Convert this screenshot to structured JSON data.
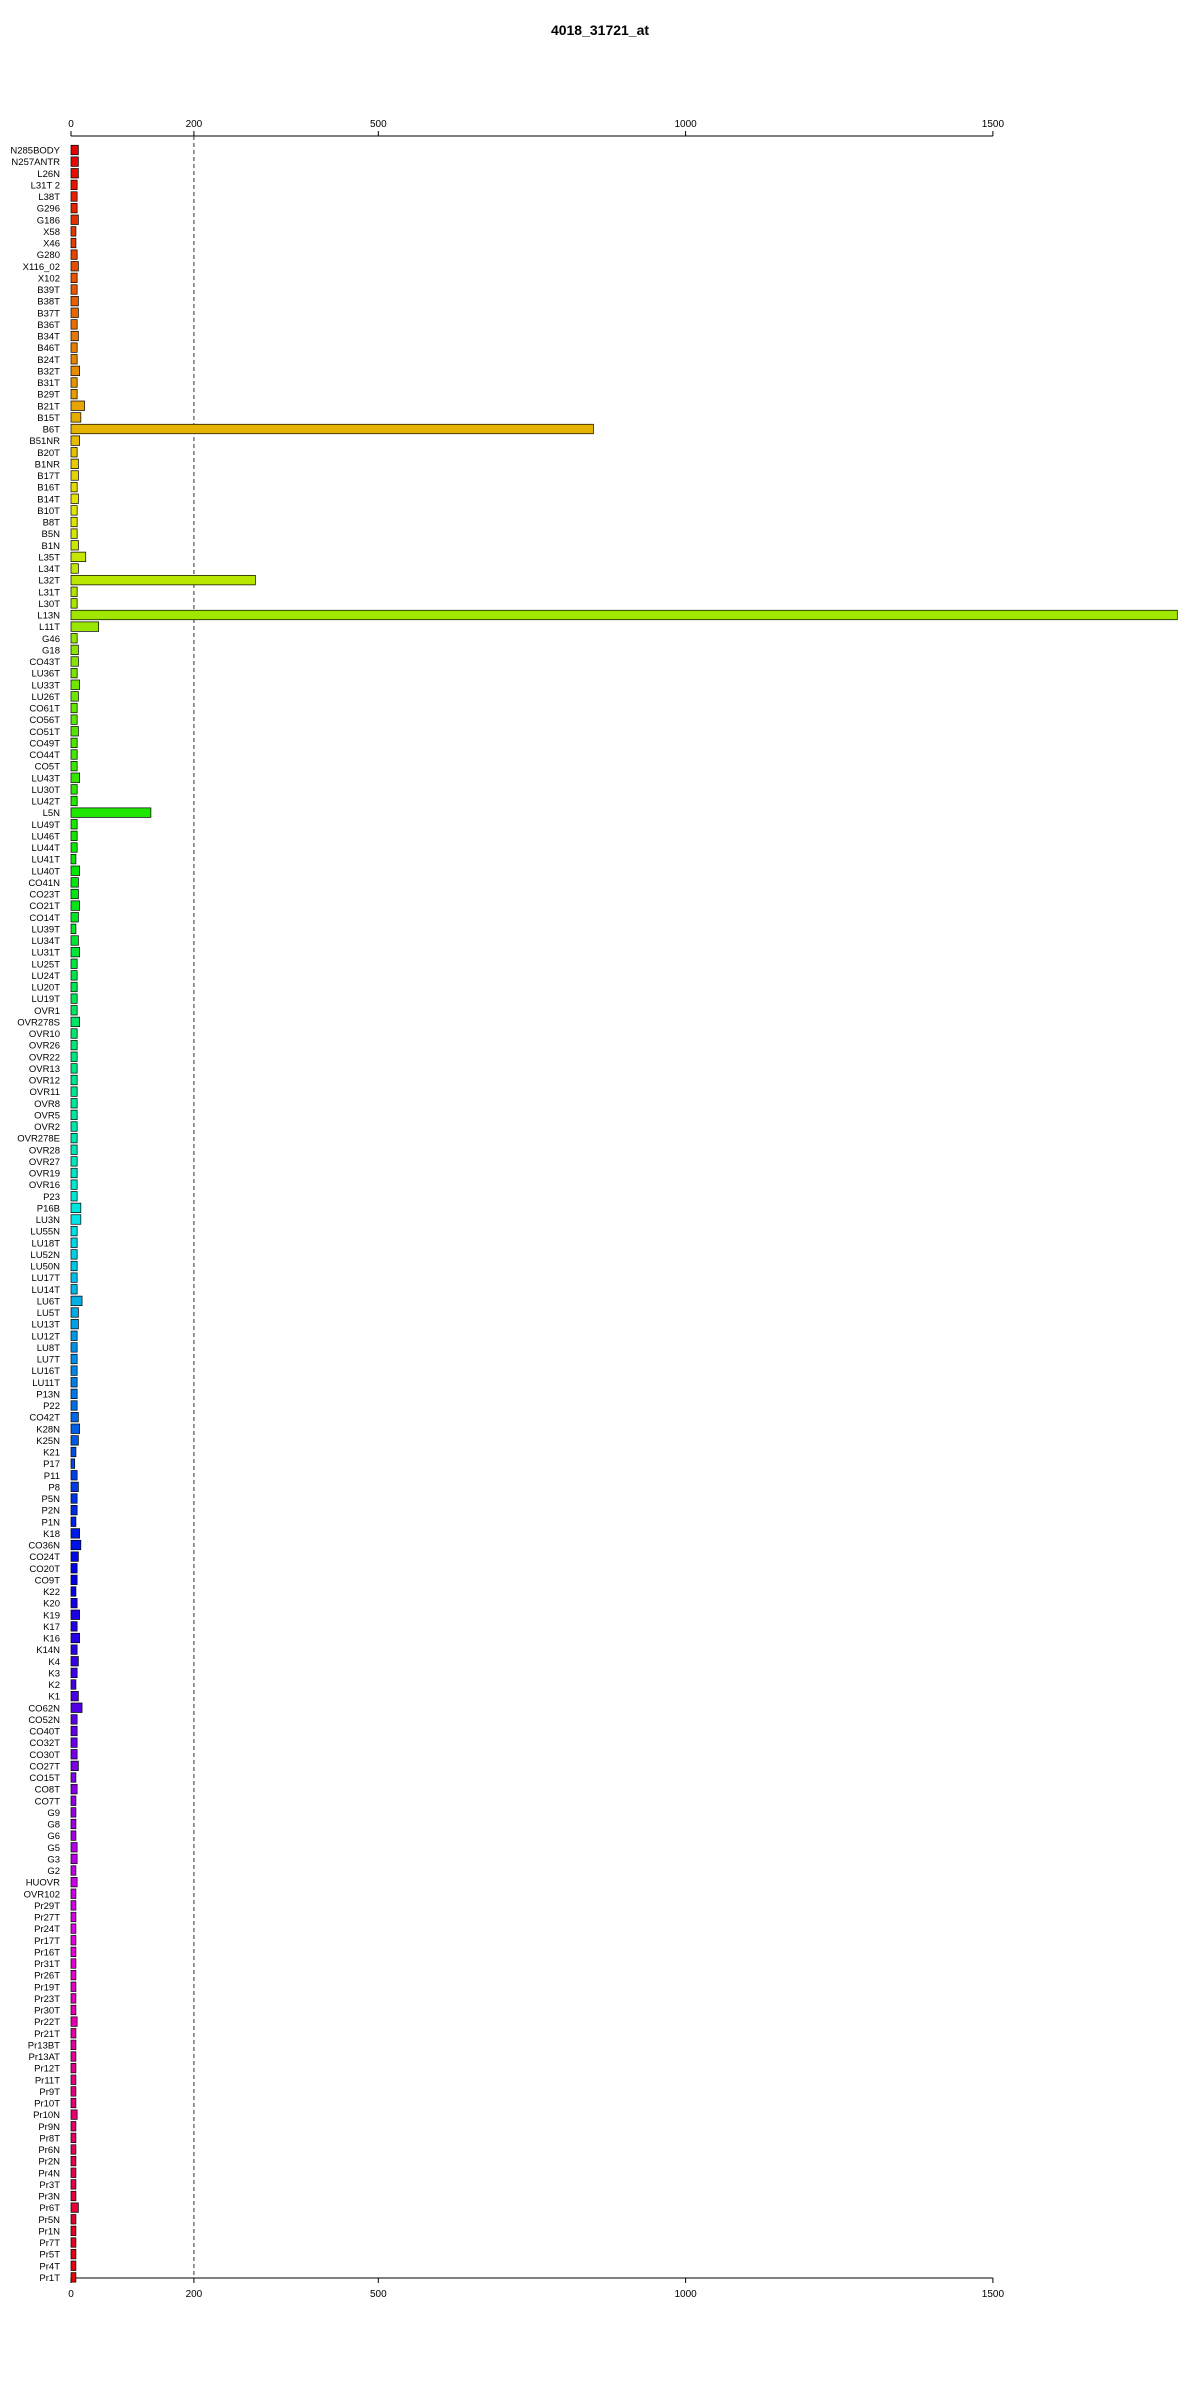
{
  "chart_data": {
    "type": "bar",
    "orientation": "horizontal",
    "title": "4018_31721_at",
    "xlim": [
      0,
      1800
    ],
    "reference_line": 200,
    "ticks": [
      {
        "value": 0,
        "label": "0"
      },
      {
        "value": 200,
        "label": "200"
      },
      {
        "value": 500,
        "label": "500"
      },
      {
        "value": 1000,
        "label": "1000"
      },
      {
        "value": 1500,
        "label": "1500"
      }
    ],
    "categories": [
      "N285BODY",
      "N257ANTR",
      "L26N",
      "L31T 2",
      "L38T",
      "G296",
      "G186",
      "X58",
      "X46",
      "G280",
      "X116_02",
      "X102",
      "B39T",
      "B38T",
      "B37T",
      "B36T",
      "B34T",
      "B46T",
      "B24T",
      "B32T",
      "B31T",
      "B29T",
      "B21T",
      "B15T",
      "B6T",
      "B51NR",
      "B20T",
      "B1NR",
      "B17T",
      "B16T",
      "B14T",
      "B10T",
      "B8T",
      "B5N",
      "B1N",
      "L35T",
      "L34T",
      "L32T",
      "L31T",
      "L30T",
      "L13N",
      "L11T",
      "G46",
      "G18",
      "CO43T",
      "LU36T",
      "LU33T",
      "LU26T",
      "CO61T",
      "CO56T",
      "CO51T",
      "CO49T",
      "CO44T",
      "CO5T",
      "LU43T",
      "LU30T",
      "LU42T",
      "L5N",
      "LU49T",
      "LU46T",
      "LU44T",
      "LU41T",
      "LU40T",
      "CO41N",
      "CO23T",
      "CO21T",
      "CO14T",
      "LU39T",
      "LU34T",
      "LU31T",
      "LU25T",
      "LU24T",
      "LU20T",
      "LU19T",
      "OVR1",
      "OVR278S",
      "OVR10",
      "OVR26",
      "OVR22",
      "OVR13",
      "OVR12",
      "OVR11",
      "OVR8",
      "OVR5",
      "OVR2",
      "OVR278E",
      "OVR28",
      "OVR27",
      "OVR19",
      "OVR16",
      "P23",
      "P16B",
      "LU3N",
      "LU55N",
      "LU18T",
      "LU52N",
      "LU50N",
      "LU17T",
      "LU14T",
      "LU6T",
      "LU5T",
      "LU13T",
      "LU12T",
      "LU8T",
      "LU7T",
      "LU16T",
      "LU11T",
      "P13N",
      "P22",
      "CO42T",
      "K28N",
      "K25N",
      "K21",
      "P17",
      "P11",
      "P8",
      "P5N",
      "P2N",
      "P1N",
      "K18",
      "CO36N",
      "CO24T",
      "CO20T",
      "CO9T",
      "K22",
      "K20",
      "K19",
      "K17",
      "K16",
      "K14N",
      "K4",
      "K3",
      "K2",
      "K1",
      "CO62N",
      "CO52N",
      "CO40T",
      "CO32T",
      "CO30T",
      "CO27T",
      "CO15T",
      "CO8T",
      "CO7T",
      "G9",
      "G8",
      "G6",
      "G5",
      "G3",
      "G2",
      "HUOVR",
      "OVR102",
      "Pr29T",
      "Pr27T",
      "Pr24T",
      "Pr17T",
      "Pr16T",
      "Pr31T",
      "Pr26T",
      "Pr19T",
      "Pr23T",
      "Pr30T",
      "Pr22T",
      "Pr21T",
      "Pr13BT",
      "Pr13AT",
      "Pr12T",
      "Pr11T",
      "Pr9T",
      "Pr10T",
      "Pr10N",
      "Pr9N",
      "Pr8T",
      "Pr6N",
      "Pr2N",
      "Pr4N",
      "Pr3T",
      "Pr3N",
      "Pr6T",
      "Pr5N",
      "Pr1N",
      "Pr7T",
      "Pr5T",
      "Pr4T",
      "Pr1T"
    ],
    "values": [
      12,
      12,
      12,
      10,
      10,
      10,
      12,
      8,
      8,
      10,
      12,
      10,
      10,
      12,
      12,
      10,
      12,
      10,
      10,
      14,
      10,
      10,
      22,
      16,
      850,
      14,
      10,
      12,
      12,
      10,
      12,
      10,
      10,
      10,
      12,
      24,
      12,
      300,
      10,
      10,
      1800,
      45,
      10,
      12,
      12,
      10,
      14,
      12,
      10,
      10,
      12,
      10,
      10,
      10,
      14,
      10,
      10,
      130,
      10,
      10,
      10,
      8,
      14,
      12,
      12,
      14,
      12,
      8,
      12,
      14,
      10,
      10,
      10,
      10,
      10,
      14,
      10,
      10,
      10,
      10,
      10,
      10,
      10,
      10,
      10,
      10,
      10,
      10,
      10,
      10,
      10,
      16,
      16,
      10,
      10,
      10,
      10,
      10,
      10,
      18,
      12,
      12,
      10,
      10,
      10,
      10,
      10,
      10,
      10,
      12,
      14,
      12,
      8,
      6,
      10,
      12,
      10,
      10,
      8,
      14,
      16,
      12,
      10,
      10,
      8,
      10,
      14,
      10,
      14,
      10,
      12,
      10,
      8,
      12,
      18,
      10,
      10,
      10,
      10,
      12,
      8,
      10,
      8,
      8,
      8,
      8,
      10,
      10,
      8,
      10,
      8,
      8,
      8,
      8,
      8,
      8,
      8,
      8,
      8,
      8,
      8,
      10,
      8,
      8,
      8,
      8,
      8,
      8,
      8,
      10,
      8,
      8,
      8,
      8,
      8,
      8,
      8,
      12,
      8,
      8,
      8,
      8,
      8,
      8
    ]
  }
}
